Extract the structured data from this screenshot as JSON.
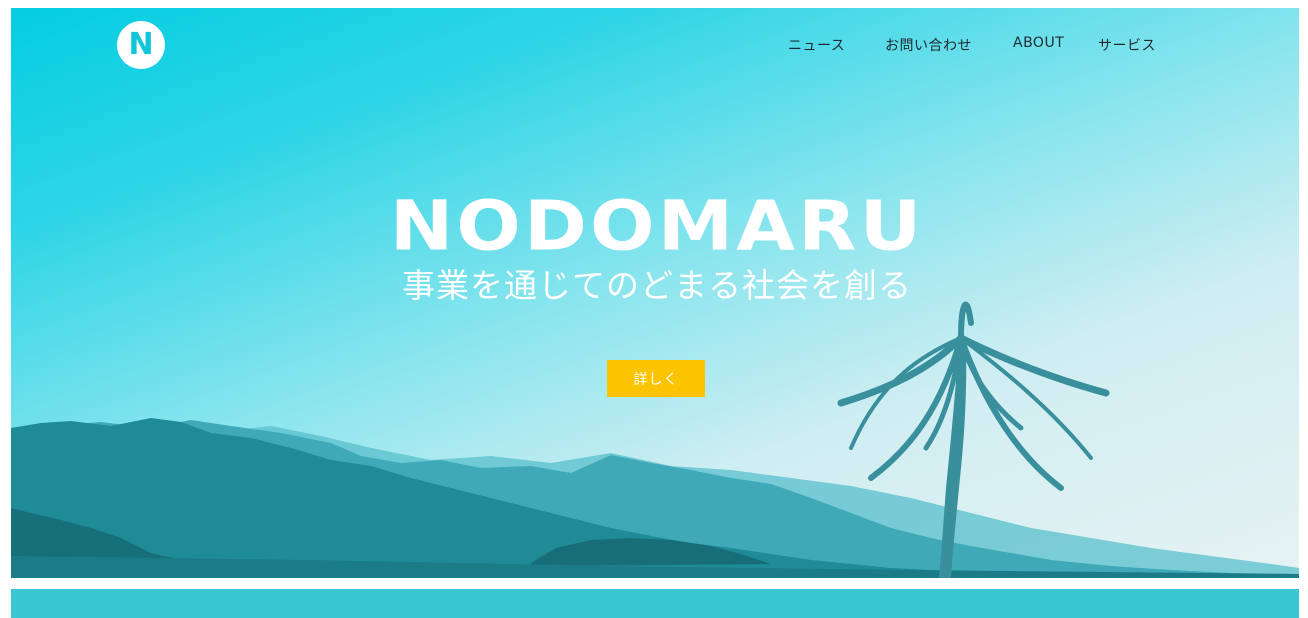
{
  "header": {
    "logo_letter": "N",
    "nav": [
      {
        "label": "ニュース"
      },
      {
        "label": "お問い合わせ"
      },
      {
        "label": "ABOUT"
      },
      {
        "label": "サービス"
      }
    ]
  },
  "hero": {
    "brand": "NODOMARU",
    "tagline": "事業を通じてのどまる社会を創る",
    "cta_label": "詳しく"
  },
  "colors": {
    "accent": "#fcc400",
    "sky_top": "#05cde2",
    "sky_bottom": "#e6f2f3",
    "mountains": "#1f8b97",
    "band": "#3bc6d3"
  }
}
